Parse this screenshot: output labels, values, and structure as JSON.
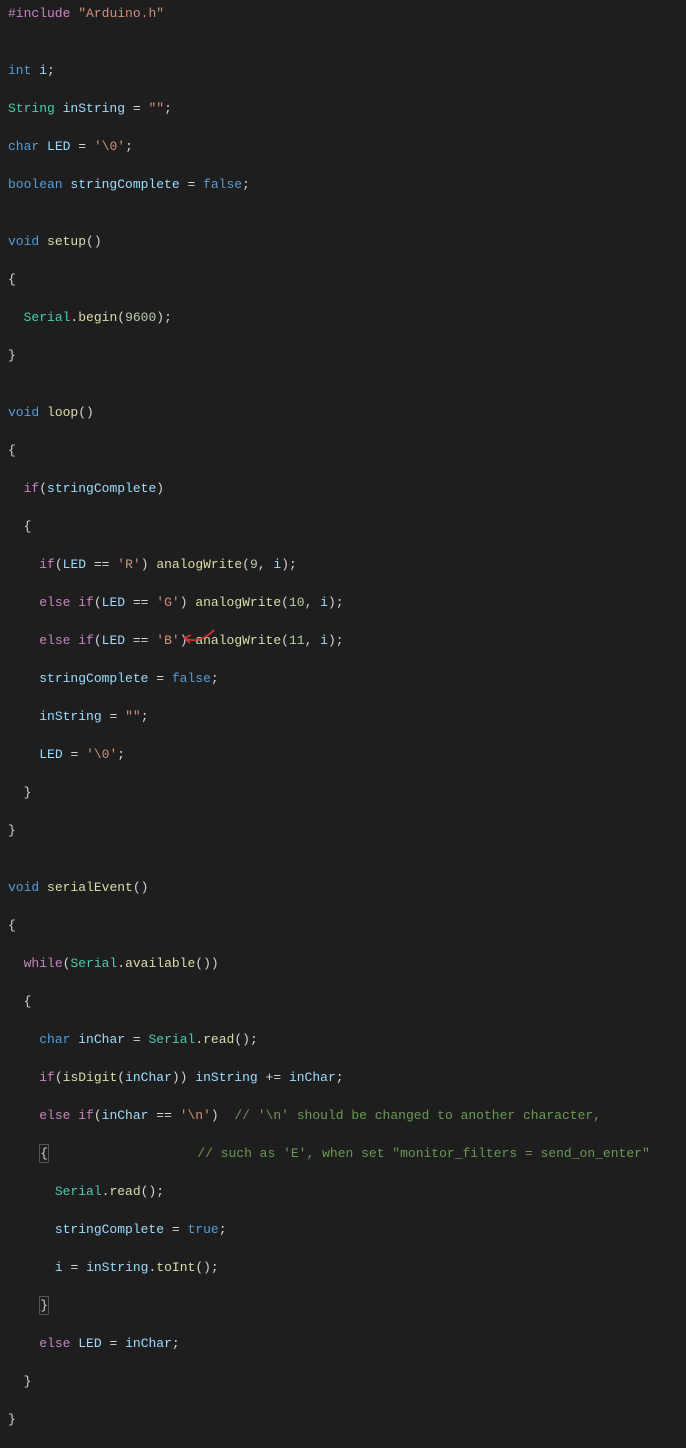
{
  "code": {
    "include": {
      "directive": "#include",
      "header": "\"Arduino.h\""
    },
    "decl": {
      "int_type": "int",
      "i": "i",
      "semi": ";",
      "string_type": "String",
      "inString": "inString",
      "eq": "=",
      "empty": "\"\"",
      "char_type": "char",
      "LED": "LED",
      "nullchar": "'\\0'",
      "bool_type": "boolean",
      "stringComplete": "stringComplete",
      "false": "false"
    },
    "setup": {
      "void": "void",
      "name": "setup",
      "parens": "()",
      "serial": "Serial",
      "dot": ".",
      "begin": "begin",
      "baud": "9600"
    },
    "loop": {
      "void": "void",
      "name": "loop",
      "parens": "()",
      "if": "if",
      "stringComplete": "stringComplete",
      "LED": "LED",
      "eqeq": "==",
      "R": "'R'",
      "G": "'G'",
      "B": "'B'",
      "analogWrite": "analogWrite",
      "pin9": "9",
      "pin10": "10",
      "pin11": "11",
      "i": "i",
      "else": "else",
      "elseif": "else if",
      "false": "false",
      "inString": "inString",
      "empty": "\"\"",
      "nullchar": "'\\0'"
    },
    "serialEvent": {
      "void": "void",
      "name": "serialEvent",
      "parens": "()",
      "while": "while",
      "Serial": "Serial",
      "available": "available",
      "char_type": "char",
      "inChar": "inChar",
      "read": "read",
      "if": "if",
      "isDigit": "isDigit",
      "inString": "inString",
      "pluseq": "+=",
      "elseif": "else if",
      "eqeq": "==",
      "newline": "'\\n'",
      "comment1": "// '\\n' should be changed to another character,",
      "comment2": "// such as 'E', when set \"monitor_filters = send_on_enter\"",
      "stringComplete": "stringComplete",
      "true": "true",
      "i": "i",
      "toInt": "toInt",
      "else": "else",
      "LED": "LED"
    }
  }
}
